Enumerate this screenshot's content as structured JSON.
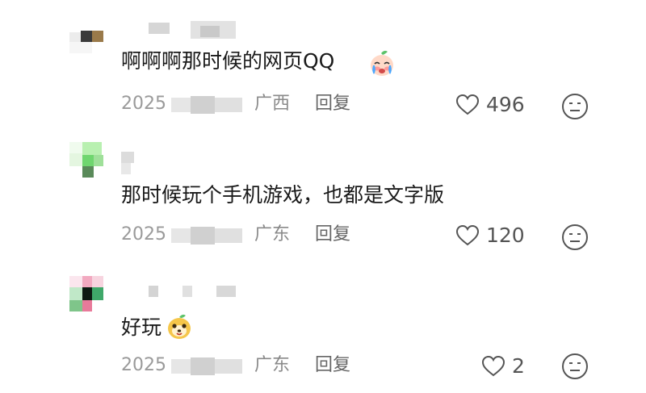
{
  "comments": [
    {
      "text": "啊啊啊那时候的网页QQ",
      "emoji": "crying-peach-emoji",
      "date_year": "2025",
      "region": "广西",
      "reply_label": "回复",
      "likes": "496",
      "avatar_colors": [
        "#e6e6e6",
        "#3a3a3a",
        "#9a7a4a"
      ]
    },
    {
      "text": "那时候玩个手机游戏，也都是文字版",
      "date_year": "2025",
      "region": "广东",
      "reply_label": "回复",
      "likes": "120",
      "avatar_colors": [
        "#b8f0b0",
        "#6fd66f",
        "#5a8a5a"
      ]
    },
    {
      "text": "好玩",
      "emoji": "smiling-mango-emoji",
      "date_year": "2025",
      "region": "广东",
      "reply_label": "回复",
      "likes": "2",
      "avatar_colors": [
        "#f2a9c0",
        "#0d1a12",
        "#3fa86a"
      ]
    }
  ]
}
